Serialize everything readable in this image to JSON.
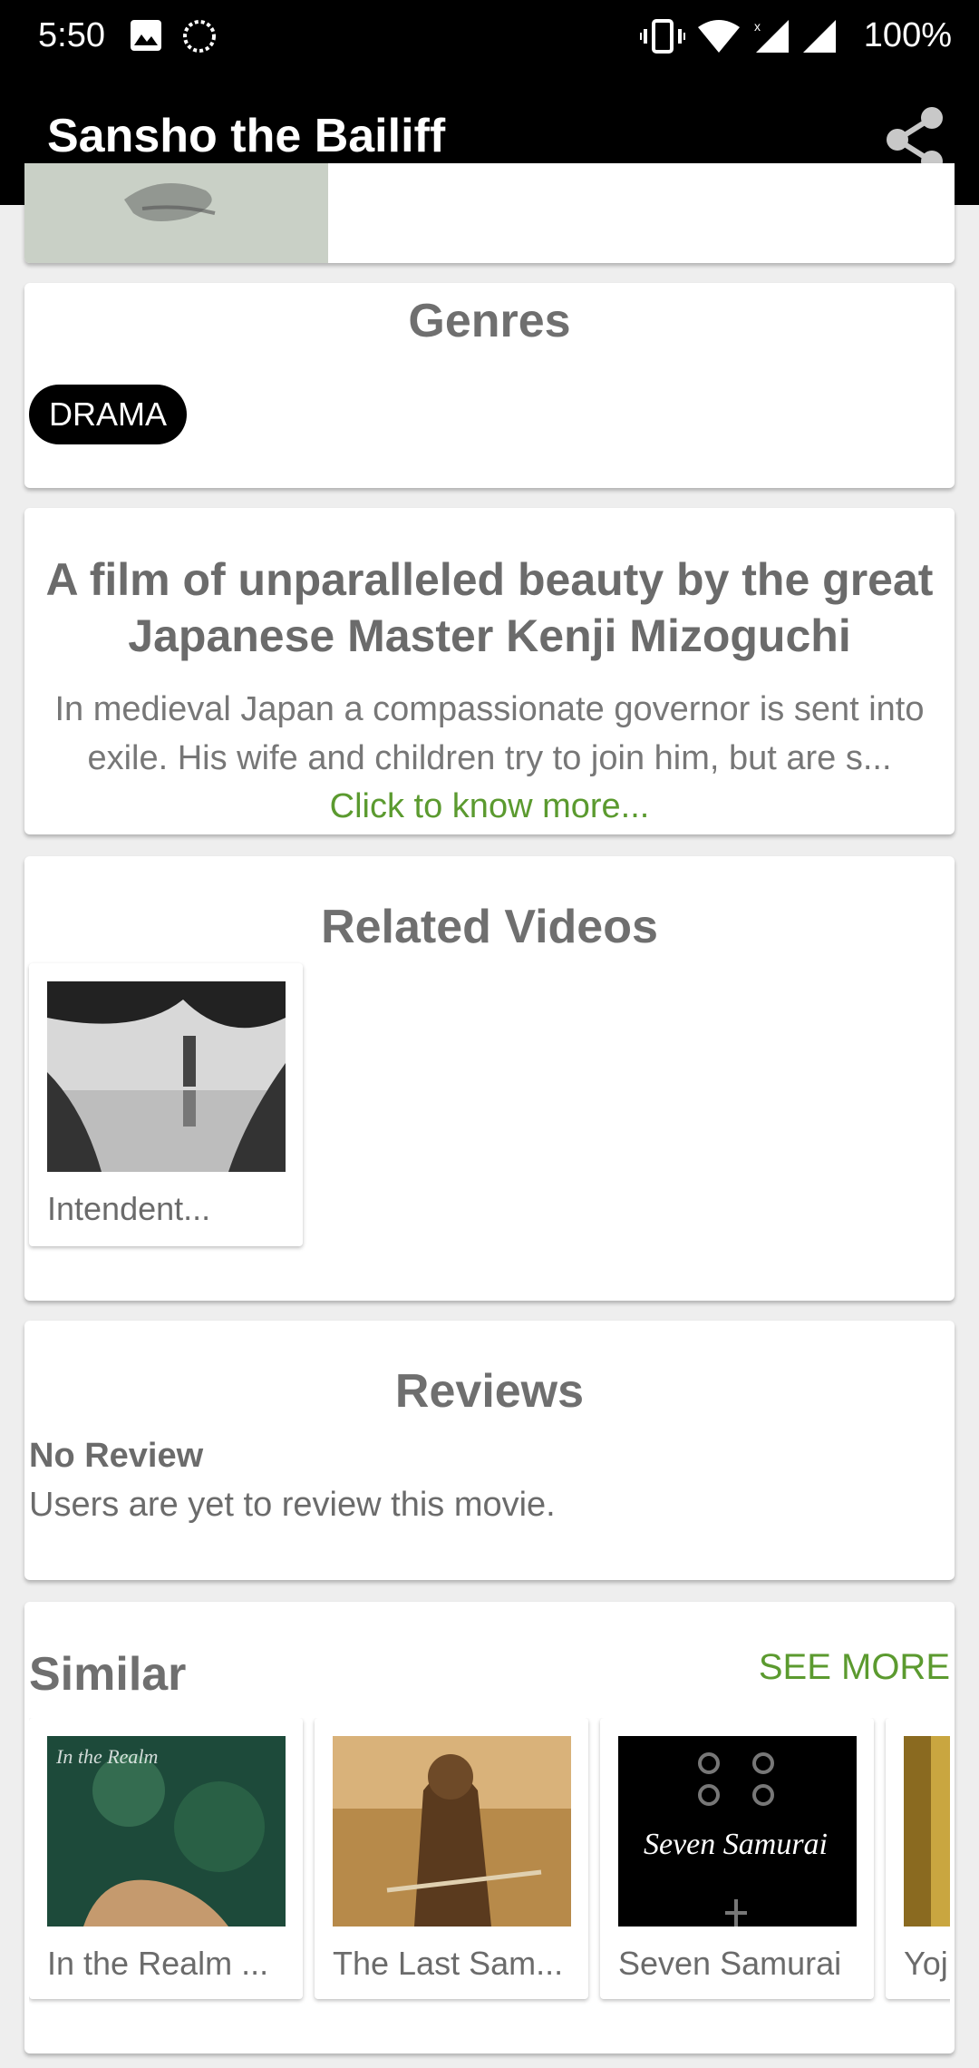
{
  "status_bar": {
    "time": "5:50",
    "battery": "100%"
  },
  "app_bar": {
    "title": "Sansho the Bailiff"
  },
  "genres": {
    "title": "Genres",
    "items": [
      "DRAMA"
    ]
  },
  "overview": {
    "tagline": "A film of unparalleled beauty by the great Japanese Master Kenji Mizoguchi",
    "synopsis": "In medieval Japan a compassionate governor is sent into exile. His wife and children try to join him, but are s...",
    "more_link": "Click to know more..."
  },
  "related": {
    "title": "Related Videos",
    "items": [
      {
        "label": "Intendent..."
      }
    ]
  },
  "reviews": {
    "title": "Reviews",
    "heading": "No Review",
    "body": "Users are yet to review this movie."
  },
  "similar": {
    "title": "Similar",
    "see_more": "SEE MORE",
    "items": [
      {
        "label": "In the Realm ..."
      },
      {
        "label": "The Last Sam..."
      },
      {
        "label": "Seven Samurai"
      },
      {
        "label": "Yoj"
      }
    ]
  }
}
